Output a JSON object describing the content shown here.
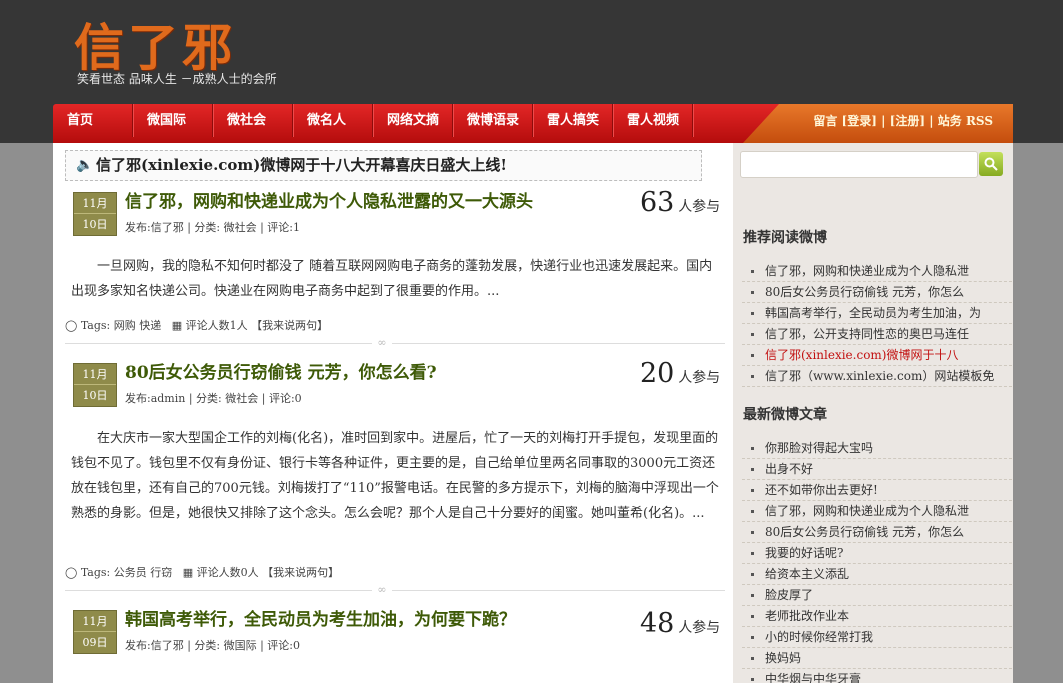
{
  "header": {
    "logo": "信了邪",
    "slogan": "笑看世态 品味人生 －成熟人士的会所"
  },
  "nav": {
    "items": [
      "首页",
      "微国际",
      "微社会",
      "微名人",
      "网络文摘",
      "微博语录",
      "雷人搞笑",
      "雷人视频"
    ],
    "links": {
      "message": "留言",
      "login": "[登录]",
      "sep1": "|",
      "register": "[注册]",
      "sep2": "|",
      "sitemap": "站务",
      "rss": "RSS"
    }
  },
  "notice": {
    "icon": "speaker-icon",
    "text": "信了邪(xinlexie.com)微博网于十八大开幕喜庆日盛大上线!"
  },
  "posts": [
    {
      "month": "11月",
      "day": "10日",
      "title": "信了邪，网购和快递业成为个人隐私泄露的又一大源头",
      "meta": "发布:信了邪 | 分类: 微社会 | 评论:1",
      "count": "63",
      "count_unit": "人参与",
      "body": "一旦网购，我的隐私不知何时都没了 随着互联网网购电子商务的蓬勃发展，快递行业也迅速发展起来。国内出现多家知名快递公司。快递业在网购电子商务中起到了很重要的作用。...",
      "tags": "Tags: 网购  快递",
      "rating": "评论人数1人",
      "reply": "【我来说两句】"
    },
    {
      "month": "11月",
      "day": "10日",
      "title": "80后女公务员行窃偷钱  元芳，你怎么看?",
      "meta": "发布:admin | 分类: 微社会 | 评论:0",
      "count": "20",
      "count_unit": "人参与",
      "body": "在大庆市一家大型国企工作的刘梅(化名)，准时回到家中。进屋后，忙了一天的刘梅打开手提包，发现里面的钱包不见了。钱包里不仅有身份证、银行卡等各种证件，更主要的是，自己给单位里两名同事取的3000元工资还放在钱包里，还有自己的700元钱。刘梅拨打了“110”报警电话。在民警的多方提示下，刘梅的脑海中浮现出一个熟悉的身影。但是，她很快又排除了这个念头。怎么会呢？那个人是自己十分要好的闺蜜。她叫董希(化名)。...",
      "tags": "Tags: 公务员  行窃",
      "rating": "评论人数0人",
      "reply": "【我来说两句】"
    },
    {
      "month": "11月",
      "day": "09日",
      "title": "韩国高考举行，全民动员为考生加油，为何要下跪？",
      "meta": "发布:信了邪 | 分类: 微国际 | 评论:0",
      "count": "48",
      "count_unit": "人参与"
    }
  ],
  "sidebar": {
    "search_placeholder": "",
    "recommend_title": "推荐阅读微博",
    "recommend": [
      "信了邪，网购和快递业成为个人隐私泄",
      "80后女公务员行窃偷钱  元芳，你怎么",
      "韩国高考举行，全民动员为考生加油，为",
      "信了邪，公开支持同性恋的奥巴马连任",
      "信了邪(xinlexie.com)微博网于十八",
      "信了邪（www.xinlexie.com）网站模板免"
    ],
    "latest_title": "最新微博文章",
    "latest": [
      "你那脸对得起大宝吗",
      "出身不好",
      "还不如带你出去更好!",
      "信了邪，网购和快递业成为个人隐私泄",
      "80后女公务员行窃偷钱  元芳，你怎么",
      "我要的好话呢?",
      "给资本主义添乱",
      "脸皮厚了",
      "老师批改作业本",
      "小的时候你经常打我",
      "换妈妈",
      "中华烟与中华牙膏"
    ],
    "accent_color": "#c21010"
  }
}
